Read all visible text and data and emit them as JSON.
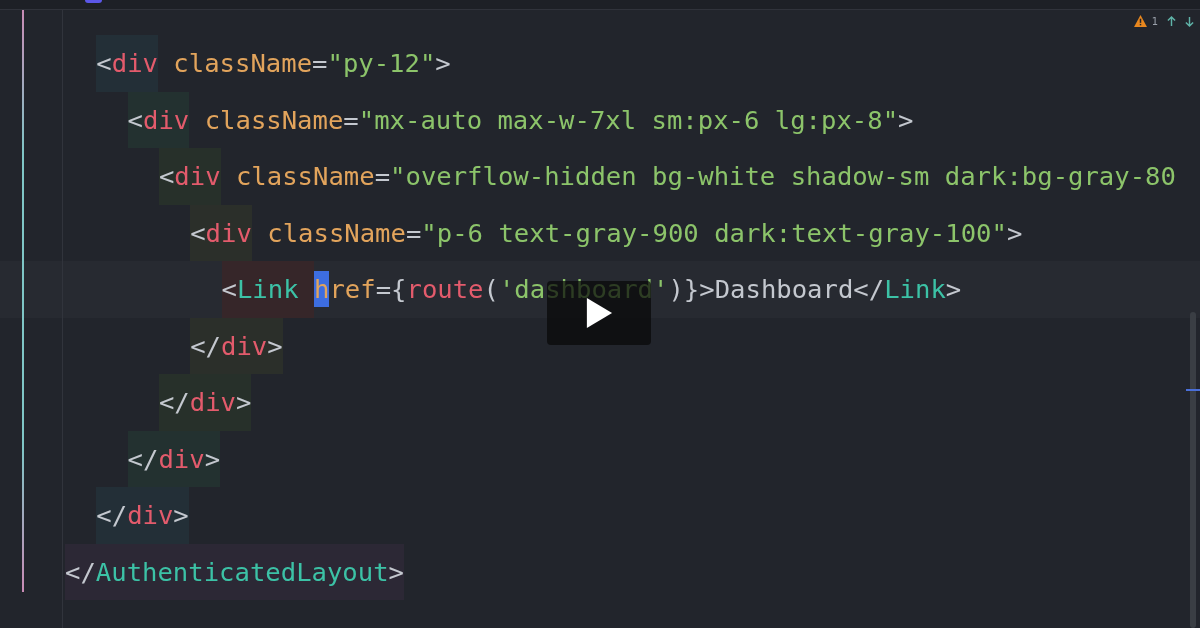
{
  "problems": {
    "warning_count": "1"
  },
  "code": {
    "close": [
      {
        "text": "</",
        "kind": "punct"
      },
      {
        "text": "AuthenticatedLayout",
        "kind": "component"
      },
      {
        "text": ">",
        "kind": "punct"
      }
    ],
    "children": [
      {
        "open": [
          {
            "text": "<",
            "kind": "punct"
          },
          {
            "text": "div",
            "kind": "html-tag"
          },
          {
            "text": "className",
            "kind": "attr"
          },
          {
            "text": "=",
            "kind": "punct"
          },
          {
            "text": "\"py-12\"",
            "kind": "string"
          },
          {
            "text": ">",
            "kind": "punct"
          }
        ],
        "close": [
          {
            "text": "</",
            "kind": "punct"
          },
          {
            "text": "div",
            "kind": "html-tag"
          },
          {
            "text": ">",
            "kind": "punct"
          }
        ],
        "children": [
          {
            "open": [
              {
                "text": "<",
                "kind": "punct"
              },
              {
                "text": "div",
                "kind": "html-tag"
              },
              {
                "text": "className",
                "kind": "attr"
              },
              {
                "text": "=",
                "kind": "punct"
              },
              {
                "text": "\"mx-auto max-w-7xl sm:px-6 lg:px-8\"",
                "kind": "string"
              },
              {
                "text": ">",
                "kind": "punct"
              }
            ],
            "close": [
              {
                "text": "</",
                "kind": "punct"
              },
              {
                "text": "div",
                "kind": "html-tag"
              },
              {
                "text": ">",
                "kind": "punct"
              }
            ],
            "children": [
              {
                "open": [
                  {
                    "text": "<",
                    "kind": "punct"
                  },
                  {
                    "text": "div",
                    "kind": "html-tag"
                  },
                  {
                    "text": "className",
                    "kind": "attr"
                  },
                  {
                    "text": "=",
                    "kind": "punct"
                  },
                  {
                    "text": "\"overflow-hidden bg-white shadow-sm dark:bg-gray-80",
                    "kind": "string"
                  }
                ],
                "close": [
                  {
                    "text": "</",
                    "kind": "punct"
                  },
                  {
                    "text": "div",
                    "kind": "html-tag"
                  },
                  {
                    "text": ">",
                    "kind": "punct"
                  }
                ],
                "children": [
                  {
                    "open": [
                      {
                        "text": "<",
                        "kind": "punct"
                      },
                      {
                        "text": "div",
                        "kind": "html-tag"
                      },
                      {
                        "text": "className",
                        "kind": "attr"
                      },
                      {
                        "text": "=",
                        "kind": "punct"
                      },
                      {
                        "text": "\"p-6 text-gray-900 dark:text-gray-100\"",
                        "kind": "string"
                      },
                      {
                        "text": ">",
                        "kind": "punct"
                      }
                    ],
                    "close": [
                      {
                        "text": "</",
                        "kind": "punct"
                      },
                      {
                        "text": "div",
                        "kind": "html-tag"
                      },
                      {
                        "text": ">",
                        "kind": "punct"
                      }
                    ],
                    "children": [
                      {
                        "open": [
                          {
                            "text": "<",
                            "kind": "punct"
                          },
                          {
                            "text": "Link ",
                            "kind": "component"
                          },
                          {
                            "text": "h",
                            "kind": "selection"
                          },
                          {
                            "text": "ref",
                            "kind": "attr"
                          },
                          {
                            "text": "=",
                            "kind": "punct"
                          },
                          {
                            "text": "{",
                            "kind": "punct"
                          },
                          {
                            "text": "route",
                            "kind": "call"
                          },
                          {
                            "text": "(",
                            "kind": "punct"
                          },
                          {
                            "text": "'dashboard'",
                            "kind": "string"
                          },
                          {
                            "text": ")}>",
                            "kind": "punct"
                          },
                          {
                            "text": "Dashboard",
                            "kind": "text"
                          },
                          {
                            "text": "</",
                            "kind": "punct"
                          },
                          {
                            "text": "Link",
                            "kind": "component"
                          },
                          {
                            "text": ">",
                            "kind": "punct"
                          }
                        ]
                      }
                    ]
                  }
                ]
              }
            ]
          }
        ]
      }
    ]
  }
}
